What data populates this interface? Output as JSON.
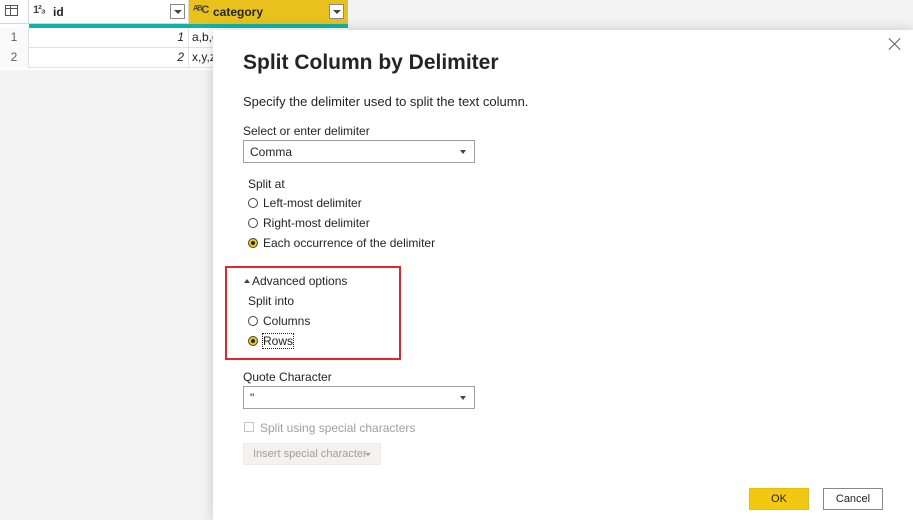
{
  "grid": {
    "columns": [
      {
        "type_icon": "1²₃",
        "name": "id"
      },
      {
        "type_icon": "ᴬᴮC",
        "name": "category"
      }
    ],
    "rows": [
      {
        "num": "1",
        "id": "1",
        "category": "a,b,c"
      },
      {
        "num": "2",
        "id": "2",
        "category": "x,y,z"
      }
    ]
  },
  "dialog": {
    "title": "Split Column by Delimiter",
    "description": "Specify the delimiter used to split the text column.",
    "delimiter_label": "Select or enter delimiter",
    "delimiter_value": "Comma",
    "split_at_label": "Split at",
    "split_at_options": [
      "Left-most delimiter",
      "Right-most delimiter",
      "Each occurrence of the delimiter"
    ],
    "split_at_selected": 2,
    "advanced_label": "Advanced options",
    "split_into_label": "Split into",
    "split_into_options": [
      "Columns",
      "Rows"
    ],
    "split_into_selected": 1,
    "quote_label": "Quote Character",
    "quote_value": "\"",
    "special_chars_label": "Split using special characters",
    "insert_special_label": "Insert special character",
    "ok_label": "OK",
    "cancel_label": "Cancel"
  },
  "colors": {
    "accent": "#f2c811",
    "highlight_box": "#e3262b",
    "teal_bar": "#11b3a8"
  }
}
